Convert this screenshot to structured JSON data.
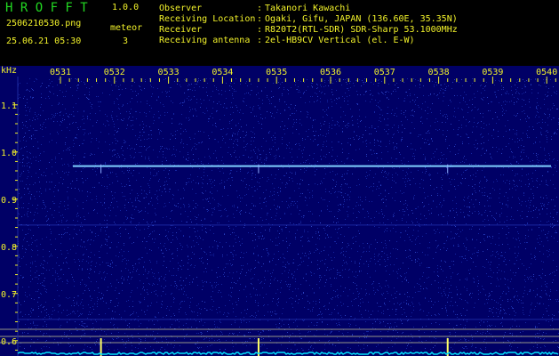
{
  "header": {
    "logo": "H R O F F T",
    "version": "1.0.0",
    "filename": "2506210530.png",
    "datetime": "25.06.21 05:30",
    "meteor_label": "meteor",
    "meteor_count": "3",
    "info": [
      {
        "label": "Observer",
        "value": "Takanori Kawachi"
      },
      {
        "label": "Receiving Location",
        "value": "Ogaki, Gifu, JAPAN (136.60E, 35.35N)"
      },
      {
        "label": "Receiver",
        "value": "R820T2(RTL-SDR) SDR-Sharp 53.1000MHz"
      },
      {
        "label": "Receiving antenna",
        "value": "2el-HB9CV Vertical (el. E-W)"
      }
    ],
    "separator": ":"
  },
  "chart_data": {
    "type": "heatmap",
    "ylabel": "kHz",
    "x_ticks": [
      "0531",
      "0532",
      "0533",
      "0534",
      "0535",
      "0536",
      "0537",
      "0538",
      "0539",
      "0540"
    ],
    "y_ticks": [
      "1.1",
      "1.0",
      "0.9",
      "0.8",
      "0.7",
      "0.6"
    ],
    "ylim": [
      0.575,
      1.16
    ],
    "xlim": [
      "05:30",
      "05:40"
    ],
    "carrier_khz": 0.97,
    "carrier_start_minute": 5310.9,
    "meteor_times": [
      "05:31:45",
      "05:34:40",
      "05:38:10"
    ],
    "colors": {
      "background": "#000066",
      "noise": "#1a2fb0",
      "carrier": "#7fd0ff",
      "ticks": "#f2f22a",
      "meteor": "#ffff66",
      "bottom_signal": "#00e5ff",
      "guide_lines": "#c8c890"
    }
  }
}
